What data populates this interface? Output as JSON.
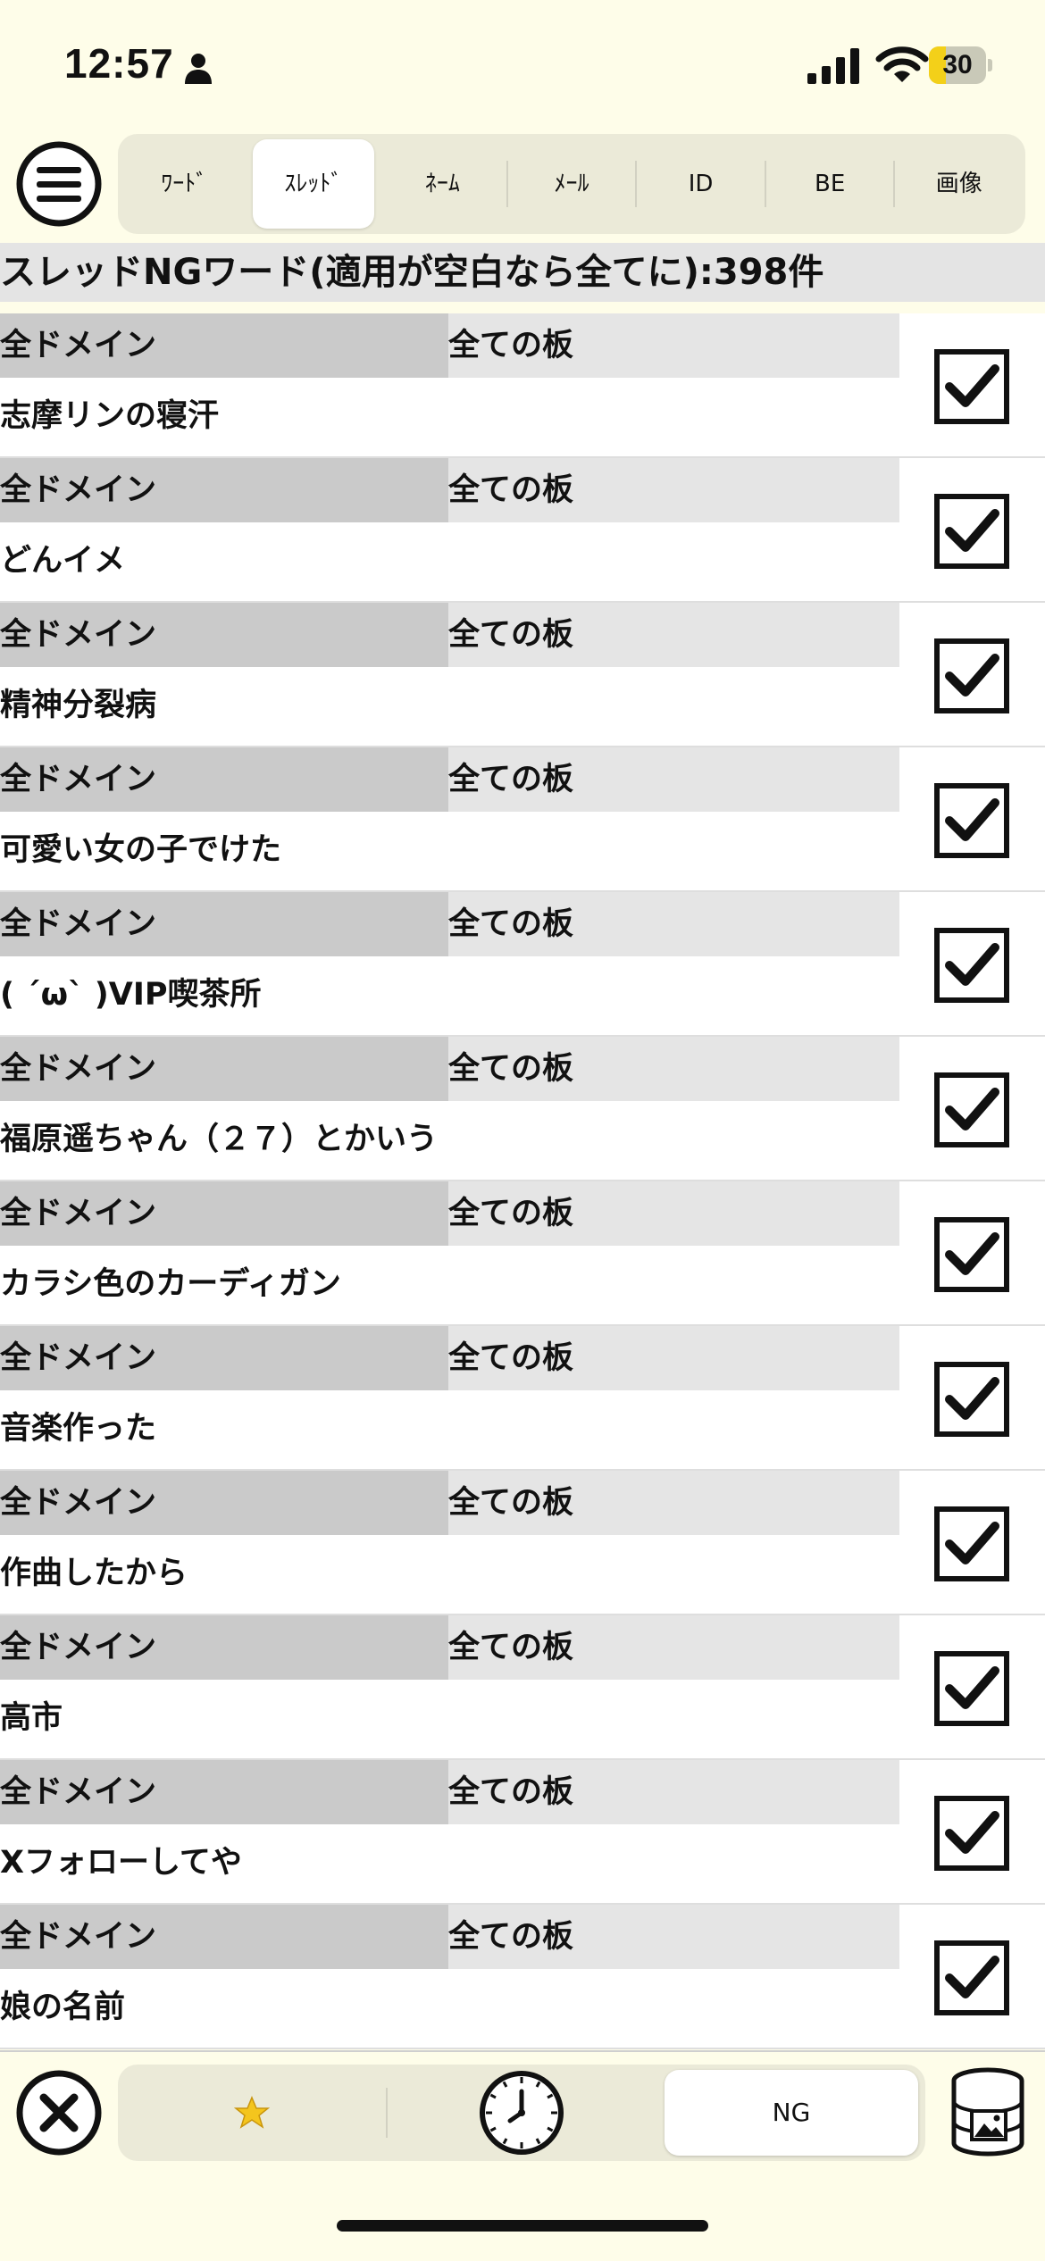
{
  "status": {
    "time": "12:57",
    "battery": "30",
    "battery_level": 0.3
  },
  "tabs": [
    {
      "label": "ﾜｰﾄﾞ",
      "selected": false
    },
    {
      "label": "ｽﾚｯﾄﾞ",
      "selected": true
    },
    {
      "label": "ﾈｰﾑ",
      "selected": false
    },
    {
      "label": "ﾒｰﾙ",
      "selected": false
    },
    {
      "label": "ID",
      "selected": false
    },
    {
      "label": "BE",
      "selected": false
    },
    {
      "label": "画像",
      "selected": false
    }
  ],
  "header": {
    "title": "スレッドNGワード(適用が空白なら全てに):398件"
  },
  "rows": [
    {
      "domain": "全ドメイン",
      "board": "全ての板",
      "word": "志摩リンの寝汗",
      "checked": true
    },
    {
      "domain": "全ドメイン",
      "board": "全ての板",
      "word": "どんイメ",
      "checked": true
    },
    {
      "domain": "全ドメイン",
      "board": "全ての板",
      "word": "精神分裂病",
      "checked": true
    },
    {
      "domain": "全ドメイン",
      "board": "全ての板",
      "word": "可愛い女の子でけた",
      "checked": true
    },
    {
      "domain": "全ドメイン",
      "board": "全ての板",
      "word": "( ´ω` )VIP喫茶所",
      "checked": true
    },
    {
      "domain": "全ドメイン",
      "board": "全ての板",
      "word": "福原遥ちゃん（２７）とかいう",
      "checked": true
    },
    {
      "domain": "全ドメイン",
      "board": "全ての板",
      "word": "カラシ色のカーディガン",
      "checked": true
    },
    {
      "domain": "全ドメイン",
      "board": "全ての板",
      "word": "音楽作った",
      "checked": true
    },
    {
      "domain": "全ドメイン",
      "board": "全ての板",
      "word": "作曲したから",
      "checked": true
    },
    {
      "domain": "全ドメイン",
      "board": "全ての板",
      "word": "高市",
      "checked": true
    },
    {
      "domain": "全ドメイン",
      "board": "全ての板",
      "word": "Xフォローしてや",
      "checked": true
    },
    {
      "domain": "全ドメイン",
      "board": "全ての板",
      "word": "娘の名前",
      "checked": true
    }
  ],
  "bottom": {
    "favorites_icon": "star-icon",
    "history_icon": "clock-icon",
    "ng_label": "NG"
  }
}
